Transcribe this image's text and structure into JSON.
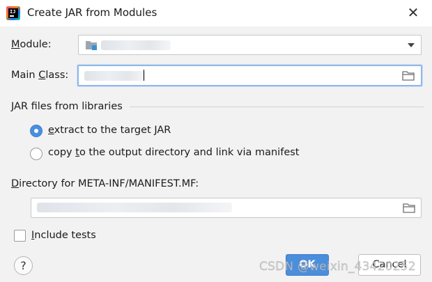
{
  "window": {
    "title": "Create JAR from Modules",
    "close_glyph": "✕",
    "app_icon": "intellij-idea-icon"
  },
  "module": {
    "label_underlined": "M",
    "label_rest": "odule:",
    "value": "",
    "icon": "module-folder-icon",
    "dropdown_icon": "chevron-down-icon"
  },
  "main_class": {
    "label_pre": "Main ",
    "label_underlined": "C",
    "label_rest": "lass:",
    "value": "",
    "browse_icon": "folder-icon"
  },
  "libraries": {
    "section_title": "JAR files from libraries",
    "option_extract_underlined": "e",
    "option_extract_rest": "xtract to the target JAR",
    "option_copy_pre": "copy ",
    "option_copy_underlined": "t",
    "option_copy_rest": "o the output directory and link via manifest",
    "selected": "extract"
  },
  "manifest": {
    "label_underlined": "D",
    "label_rest": "irectory for META-INF/MANIFEST.MF:",
    "value": "",
    "browse_icon": "folder-icon"
  },
  "include_tests": {
    "label_underlined": "I",
    "label_rest": "nclude tests",
    "checked": false
  },
  "footer": {
    "help_glyph": "?",
    "ok_label": "OK",
    "cancel_label": "Cancel"
  },
  "watermark": "CSDN @weixin_43420252",
  "colors": {
    "accent": "#4b8edc",
    "background": "#f2f2f2",
    "focus_border": "#8fb8e8"
  }
}
